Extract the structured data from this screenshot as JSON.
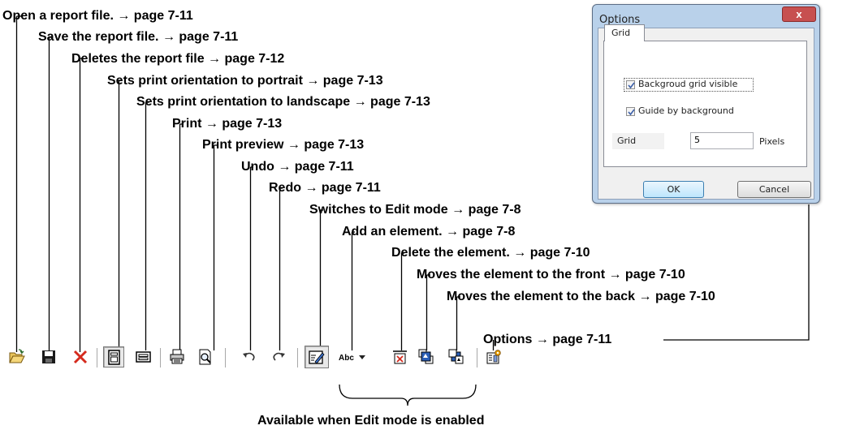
{
  "annotations": [
    "Open a report file. → page 7-11",
    "Save the report file. → page 7-11",
    "Deletes the report file → page 7-12",
    "Sets print orientation to portrait → page 7-13",
    "Sets print orientation to landscape → page 7-13",
    "Print → page 7-13",
    "Print preview → page 7-13",
    "Undo → page 7-11",
    "Redo → page 7-11",
    "Switches to Edit mode → page 7-8",
    "Add an element. → page 7-8",
    "Delete the element. → page 7-10",
    "Moves the element to the front → page 7-10",
    "Moves the element to the back → page 7-10",
    "Options → page 7-11"
  ],
  "edit_mode_note": "Available when Edit mode is enabled",
  "toolbar": {
    "buttons": [
      {
        "icon": "open-folder-icon",
        "pressed": false
      },
      {
        "icon": "save-disk-icon",
        "pressed": false
      },
      {
        "icon": "delete-x-icon",
        "pressed": false
      },
      {
        "icon": "portrait-icon",
        "pressed": true
      },
      {
        "icon": "landscape-icon",
        "pressed": false
      },
      {
        "icon": "printer-icon",
        "pressed": false
      },
      {
        "icon": "print-preview-icon",
        "pressed": false
      },
      {
        "icon": "undo-icon",
        "pressed": false
      },
      {
        "icon": "redo-icon",
        "pressed": false
      },
      {
        "icon": "edit-mode-icon",
        "pressed": true
      },
      {
        "icon": "add-text-element-icon",
        "text": "Abc",
        "pressed": false
      },
      {
        "icon": "dropdown-arrow-icon",
        "pressed": false
      },
      {
        "icon": "delete-element-icon",
        "pressed": false
      },
      {
        "icon": "bring-to-front-icon",
        "pressed": false
      },
      {
        "icon": "send-to-back-icon",
        "pressed": false
      },
      {
        "icon": "options-icon",
        "pressed": false
      }
    ]
  },
  "dialog": {
    "title": "Options",
    "close_label": "x",
    "tab_label": "Grid",
    "checkbox1_label": "Backgroud grid visible",
    "checkbox1_checked": true,
    "checkbox2_label": "Guide by background",
    "checkbox2_checked": true,
    "grid_label": "Grid",
    "grid_value": "5",
    "grid_unit": "Pixels",
    "ok_label": "OK",
    "cancel_label": "Cancel"
  },
  "colors": {
    "dialog_frame": "#b9d1ea",
    "close_button": "#c75050",
    "ok_button": "#bee6fd",
    "delete_red": "#d52b1e",
    "icon_blue": "#2b5fb7"
  }
}
